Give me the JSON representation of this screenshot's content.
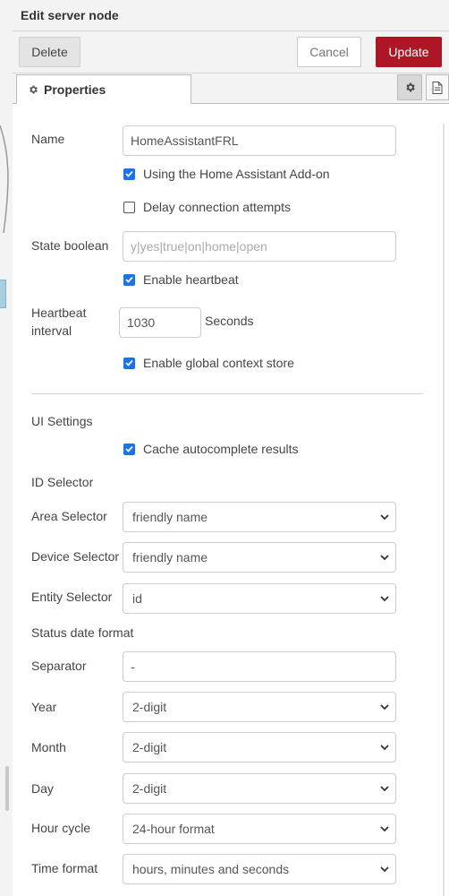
{
  "header": {
    "title": "Edit server node"
  },
  "toolbar": {
    "delete_label": "Delete",
    "cancel_label": "Cancel",
    "update_label": "Update"
  },
  "tabs": {
    "properties_label": "Properties"
  },
  "form": {
    "name": {
      "label": "Name",
      "value": "HomeAssistantFRL"
    },
    "addon": {
      "label": "Using the Home Assistant Add-on",
      "checked": true
    },
    "delay": {
      "label": "Delay connection attempts",
      "checked": false
    },
    "state_boolean": {
      "label": "State boolean",
      "placeholder": "y|yes|true|on|home|open"
    },
    "heartbeat": {
      "label": "Enable heartbeat",
      "checked": true
    },
    "heartbeat_interval": {
      "label_line1": "Heartbeat",
      "label_line2": "interval",
      "value": "1030",
      "unit": "Seconds"
    },
    "global_context": {
      "label": "Enable global context store",
      "checked": true
    },
    "ui_settings": {
      "label": "UI Settings"
    },
    "cache": {
      "label": "Cache autocomplete results",
      "checked": true
    },
    "id_selector": {
      "label": "ID Selector"
    },
    "area_selector": {
      "label": "Area Selector",
      "value": "friendly name"
    },
    "device_selector": {
      "label": "Device Selector",
      "value": "friendly name"
    },
    "entity_selector": {
      "label": "Entity Selector",
      "value": "id"
    },
    "status_date_format": {
      "label": "Status date format"
    },
    "separator": {
      "label": "Separator",
      "value": "-"
    },
    "year": {
      "label": "Year",
      "value": "2-digit"
    },
    "month": {
      "label": "Month",
      "value": "2-digit"
    },
    "day": {
      "label": "Day",
      "value": "2-digit"
    },
    "hour_cycle": {
      "label": "Hour cycle",
      "value": "24-hour format"
    },
    "time_format": {
      "label": "Time format",
      "value": "hours, minutes and seconds"
    }
  },
  "colors": {
    "update_button": "#ad1625",
    "checkbox_checked": "#1a73e8"
  }
}
